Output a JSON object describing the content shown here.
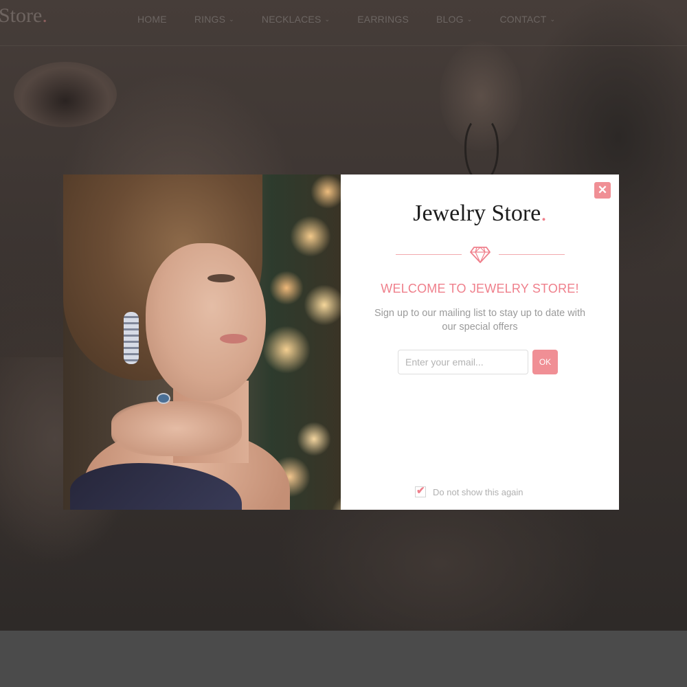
{
  "nav": {
    "brand_text": "Store",
    "brand_dot": ".",
    "items": [
      {
        "label": "HOME",
        "has_dropdown": false
      },
      {
        "label": "RINGS",
        "has_dropdown": true
      },
      {
        "label": "NECKLACES",
        "has_dropdown": true
      },
      {
        "label": "EARRINGS",
        "has_dropdown": false
      },
      {
        "label": "BLOG",
        "has_dropdown": true
      },
      {
        "label": "CONTACT",
        "has_dropdown": true
      }
    ]
  },
  "popup": {
    "close_glyph": "✕",
    "logo_text": "Jewelry Store",
    "logo_dot": ".",
    "heading": "WELCOME TO JEWELRY STORE!",
    "subtext": "Sign up to our mailing list to stay up to date with our special offers",
    "email_placeholder": "Enter your email...",
    "email_value": "",
    "submit_label": "OK",
    "dont_show_label": "Do not show this again",
    "dont_show_checked": true
  },
  "colors": {
    "accent": "#ef7f8b",
    "button": "#f08f95",
    "overlay_bg": "#3a3330"
  },
  "icons": {
    "close": "close-icon",
    "divider": "diamond-icon",
    "dropdown": "chevron-down-icon",
    "checkbox": "checkmark-icon"
  }
}
